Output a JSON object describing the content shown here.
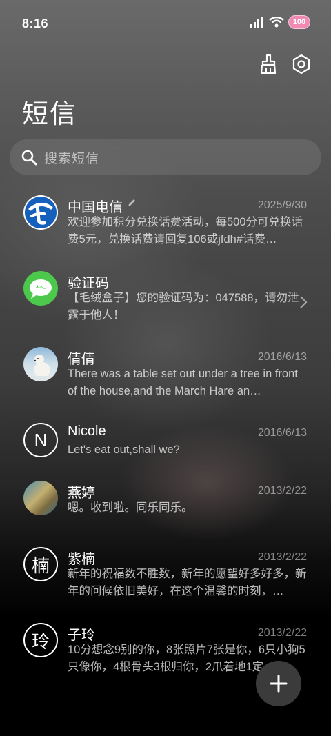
{
  "status_bar": {
    "time": "8:16",
    "battery": "100"
  },
  "header": {
    "title": "短信"
  },
  "search": {
    "placeholder": "搜索短信"
  },
  "conversations": [
    {
      "name": "中国电信",
      "date": "2025/9/30",
      "preview": "欢迎参加积分兑换话费活动，每500分可兑换话费5元，兑换话费请回复106或jfdh#话费…",
      "avatar": "telecom-logo"
    },
    {
      "name": "验证码",
      "date": "",
      "preview": "【毛绒盒子】您的验证码为：047588，请勿泄露于他人！",
      "avatar": "sms-icon"
    },
    {
      "name": "倩倩",
      "date": "2016/6/13",
      "preview": "There was a table set out under a tree in front of the house,and the March Hare an…",
      "avatar": "polar-bear-photo"
    },
    {
      "name": "Nicole",
      "date": "2016/6/13",
      "preview": "Let's eat out,shall we?",
      "avatar_letter": "N"
    },
    {
      "name": "燕婷",
      "date": "2013/2/22",
      "preview": "嗯。收到啦。同乐同乐。",
      "avatar": "landscape-photo"
    },
    {
      "name": "紫楠",
      "date": "2013/2/22",
      "preview": "新年的祝福数不胜数，新年的愿望好多好多，新年的问候依旧美好，在这个温馨的时刻，…",
      "avatar_letter": "楠"
    },
    {
      "name": "子玲",
      "date": "2013/2/22",
      "preview": "10分想念9别的你，8张照片7张是你，6只小狗5只像你，4根骨头3根归你，2爪着地1定…",
      "avatar_letter": "玲"
    }
  ],
  "colors": {
    "sms_green": "#4cc94c",
    "telecom_blue": "#1560bd",
    "battery_pink": "#f08ab3"
  }
}
